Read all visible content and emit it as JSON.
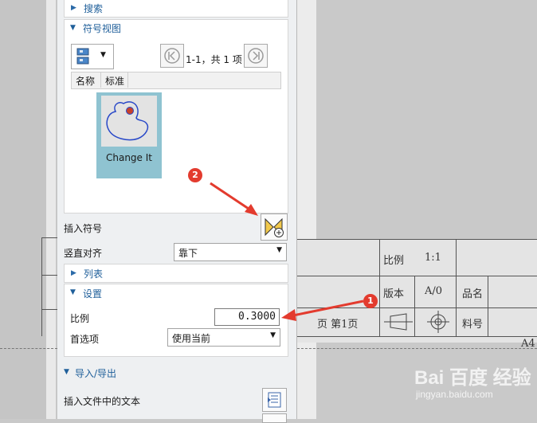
{
  "panel": {
    "search": {
      "label": "搜索"
    },
    "symbol_view": {
      "label": "符号视图",
      "pager_text": "1-1，共 1 项",
      "columns": [
        "名称",
        "标准"
      ],
      "items": [
        {
          "name": "Change It"
        }
      ]
    },
    "insert_symbol": {
      "label": "插入符号"
    },
    "vertical_align": {
      "label": "竖直对齐",
      "value": "靠下"
    },
    "list": {
      "label": "列表"
    },
    "settings": {
      "label": "设置",
      "scale_label": "比例",
      "scale_value": "0.3000",
      "preference_label": "首选项",
      "preference_value": "使用当前"
    },
    "import_export": {
      "label": "导入/导出",
      "insert_text_label": "插入文件中的文本"
    }
  },
  "drawing": {
    "title_block": {
      "scale_label": "比例",
      "scale_value": "1:1",
      "version_label": "版本",
      "version_value": "A/0",
      "part_name_label": "品名",
      "page_text": "页 第1页",
      "material_label": "料号",
      "sheet_size": "A4"
    }
  },
  "annotations": {
    "badge_1": "1",
    "badge_2": "2"
  },
  "watermark": {
    "brand": "Bai 百度 经验",
    "url": "jingyan.baidu.com"
  },
  "colors": {
    "accent": "#1f5f9a",
    "badge": "#e33b2e",
    "symbol_bg": "#8fc3d1"
  }
}
